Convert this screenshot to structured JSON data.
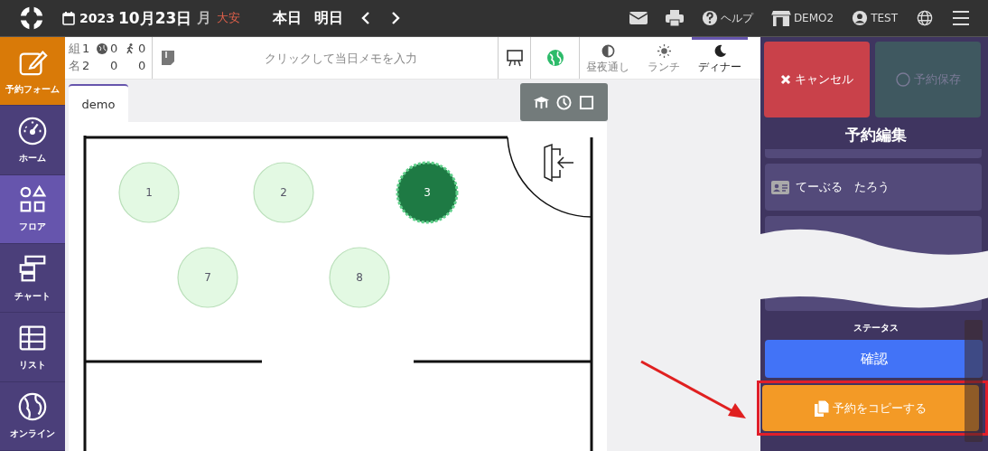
{
  "header": {
    "year": "2023",
    "date": "10月23日",
    "weekday": "月",
    "rokuyo": "大安",
    "today": "本日",
    "tomorrow": "明日",
    "help": "ヘルプ",
    "store": "DEMO2",
    "user": "TEST"
  },
  "sidebar": [
    {
      "label": "予約フォーム",
      "kind": "form",
      "selected": false
    },
    {
      "label": "ホーム",
      "kind": "home",
      "selected": false
    },
    {
      "label": "フロア",
      "kind": "floor",
      "selected": true
    },
    {
      "label": "チャート",
      "kind": "chart",
      "selected": false
    },
    {
      "label": "リスト",
      "kind": "list",
      "selected": false
    },
    {
      "label": "オンライン",
      "kind": "online",
      "selected": false
    }
  ],
  "counts": [
    {
      "label": "組",
      "total": "1",
      "online": "0",
      "walkin": "0"
    },
    {
      "label": "名",
      "total": "2",
      "online": "0",
      "walkin": "0"
    }
  ],
  "memo": {
    "placeholder": "クリックして当日メモを入力"
  },
  "modes": [
    {
      "label": "昼夜通し",
      "kind": "half",
      "selected": false
    },
    {
      "label": "ランチ",
      "kind": "sun",
      "selected": false
    },
    {
      "label": "ディナー",
      "kind": "moon",
      "selected": true
    }
  ],
  "floor": {
    "tab": "demo",
    "tables": [
      {
        "number": "1",
        "selected": false
      },
      {
        "number": "2",
        "selected": false
      },
      {
        "number": "3",
        "selected": true
      },
      {
        "number": "7",
        "selected": false
      },
      {
        "number": "8",
        "selected": false
      }
    ]
  },
  "panel": {
    "cancel": "キャンセル",
    "save": {
      "label": "予約保存",
      "disabled": true
    },
    "title": "予約編集",
    "guest": "てーぶる　たろう",
    "status_label": "ステータス",
    "status": "確認",
    "copy": "予約をコピーする"
  }
}
